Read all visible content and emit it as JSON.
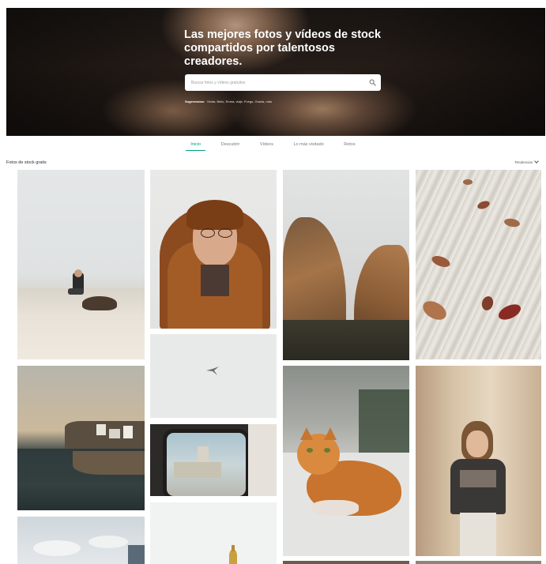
{
  "hero": {
    "title": "Las mejores fotos y vídeos de stock compartidos por talentosos creadores.",
    "search_placeholder": "Buscar fotos y vídeos gratuitos",
    "suggestions_label": "Sugerencias:",
    "suggestions": "Moda, Bello, Roma, viaje, Fuego, Gracia, más"
  },
  "tabs": [
    {
      "label": "Inicio",
      "active": true
    },
    {
      "label": "Descubrir",
      "active": false
    },
    {
      "label": "Vídeos",
      "active": false
    },
    {
      "label": "Lo más visitado",
      "active": false
    },
    {
      "label": "Retos",
      "active": false
    }
  ],
  "section": {
    "title": "Fotos de stock gratis",
    "sort_label": "Tendencias"
  },
  "colors": {
    "accent": "#05a081",
    "hero_text": "#ffffff"
  },
  "icons": {
    "search": "search-icon",
    "sort": "chevron-down-icon"
  }
}
